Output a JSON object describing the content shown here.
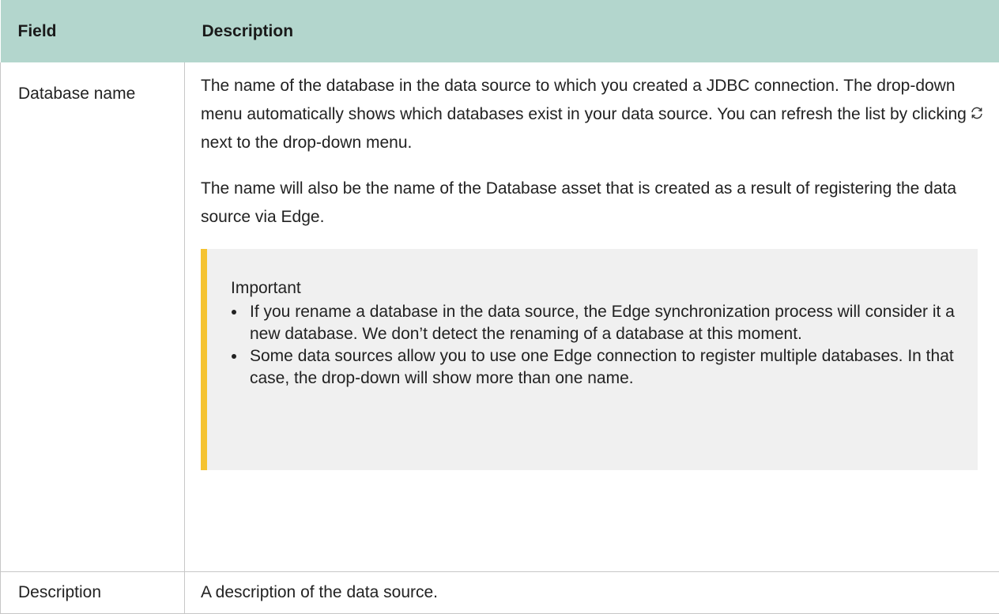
{
  "table": {
    "headers": [
      "Field",
      "Description"
    ],
    "rows": [
      {
        "field": "Database name",
        "paragraph1_before": "The name of the database in the data source to which you created a JDBC connection. The drop-down menu automatically shows which databases exist in your data source. You can refresh the list by clicking",
        "paragraph1_icon": "refresh-icon",
        "paragraph1_after": "next to the drop-down menu.",
        "paragraph2": "The name will also be the name of the Database asset that is created as a result of registering the data source via Edge.",
        "note": {
          "title": "Important",
          "items": [
            "If you rename a database in the data source, the Edge synchronization process will consider it a new database. We don’t detect the renaming of a database at this moment.",
            "Some data sources allow you to use one Edge connection to register multiple databases. In that case, the drop-down will show more than one name."
          ]
        }
      },
      {
        "field": "Description",
        "description": "A description of the data source."
      }
    ]
  },
  "colors": {
    "header_bg": "#b3d6cd",
    "note_bg": "#f0f0f0",
    "note_accent": "#f5c331",
    "border": "#c7c7c7"
  }
}
